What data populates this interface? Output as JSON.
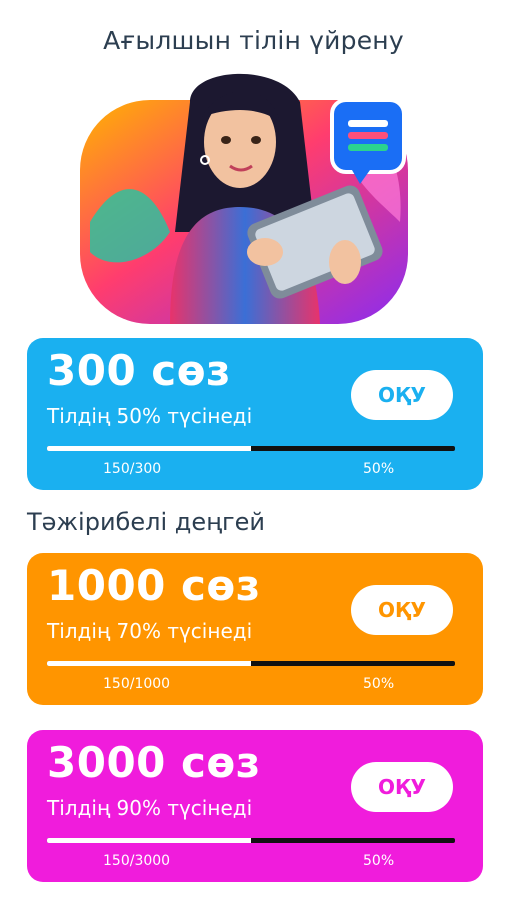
{
  "header": {
    "title": "Ағылшын тілін үйрену"
  },
  "section": {
    "title": "Тәжірибелі деңгей"
  },
  "colors": {
    "blue": "#1ab0f0",
    "orange": "#ff9500",
    "magenta": "#f01cdc"
  },
  "hero_icons": [
    "woman-with-tablet-illustration",
    "chat-bubble-icon"
  ],
  "cards": [
    {
      "title": "300 сөз",
      "subtitle": "Тілдің 50% түсінеді",
      "button": "ОҚУ",
      "progress_text": "150/300",
      "percent_text": "50%",
      "progress": 0.5,
      "color": "#1ab0f0"
    },
    {
      "title": "1000 сөз",
      "subtitle": "Тілдің 70% түсінеді",
      "button": "ОҚУ",
      "progress_text": "150/1000",
      "percent_text": "50%",
      "progress": 0.5,
      "color": "#ff9500"
    },
    {
      "title": "3000 сөз",
      "subtitle": "Тілдің 90% түсінеді",
      "button": "ОҚУ",
      "progress_text": "150/3000",
      "percent_text": "50%",
      "progress": 0.5,
      "color": "#f01cdc"
    }
  ]
}
